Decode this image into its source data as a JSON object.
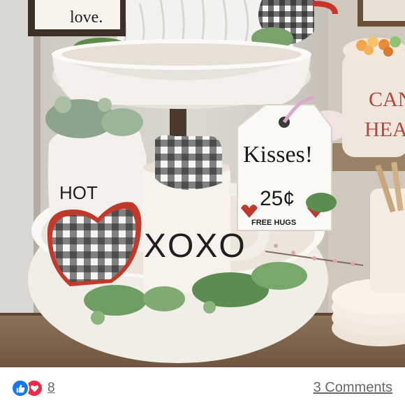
{
  "photo": {
    "sign_text": "love.",
    "tag_title": "Kisses!",
    "tag_price": "25¢",
    "tag_footer": "FREE HUGS",
    "mug_text": "XOXO",
    "pitcher_text": "HOT",
    "canister_text_1": "CAN",
    "canister_text_2": "HEAR"
  },
  "footer": {
    "reactions": {
      "like_icon": "like-icon",
      "love_icon": "love-icon",
      "count": "8",
      "like_color": "#1877f2",
      "love_color": "#f0284a"
    },
    "comments_link": "3 Comments"
  }
}
